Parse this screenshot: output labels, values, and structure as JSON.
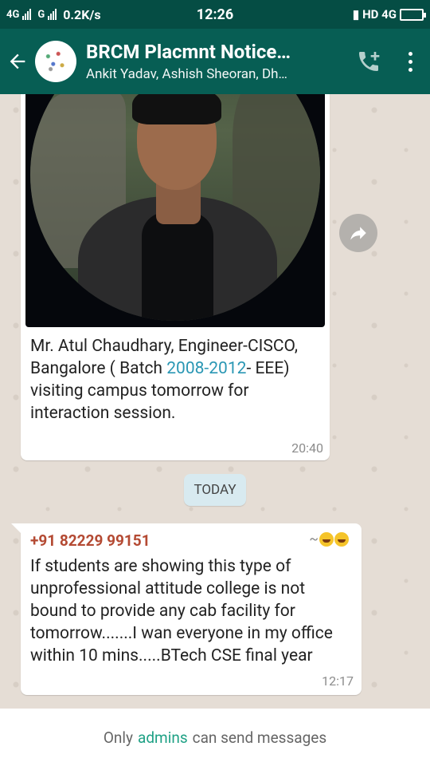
{
  "status_bar": {
    "network_left": "4G",
    "network_mid": "G",
    "speed": "0.2K/s",
    "time": "12:26",
    "right": "HD 4G"
  },
  "header": {
    "title": "BRCM Placmnt Notice…",
    "subtitle": "Ankit Yadav, Ashish Sheoran, Dh…",
    "icons": [
      "back-arrow-icon",
      "group-avatar",
      "add-call-icon",
      "more-vert-icon"
    ]
  },
  "messages": [
    {
      "type": "image",
      "caption_pre": "Mr. Atul Chaudhary, Engineer-CISCO, Bangalore ( Batch ",
      "caption_link": "2008-2012",
      "caption_post": "- EEE) visiting campus tomorrow for interaction session.",
      "time": "20:40"
    },
    {
      "type": "text",
      "sender": "+91 82229 99151",
      "push_name": "~",
      "text": "If students are showing this type of unprofessional attitude college is not bound to provide any cab facility for tomorrow.......I wan everyone in my office within 10 mins.....BTech CSE final year",
      "time": "12:17"
    }
  ],
  "date_divider": "TODAY",
  "footer": {
    "prefix": "Only",
    "admins": "admins",
    "suffix": "can send messages"
  },
  "colors": {
    "header": "#075e54",
    "status_bar": "#054d44",
    "link": "#2a97b4",
    "sender": "#b44a33",
    "admins": "#1fa185"
  }
}
